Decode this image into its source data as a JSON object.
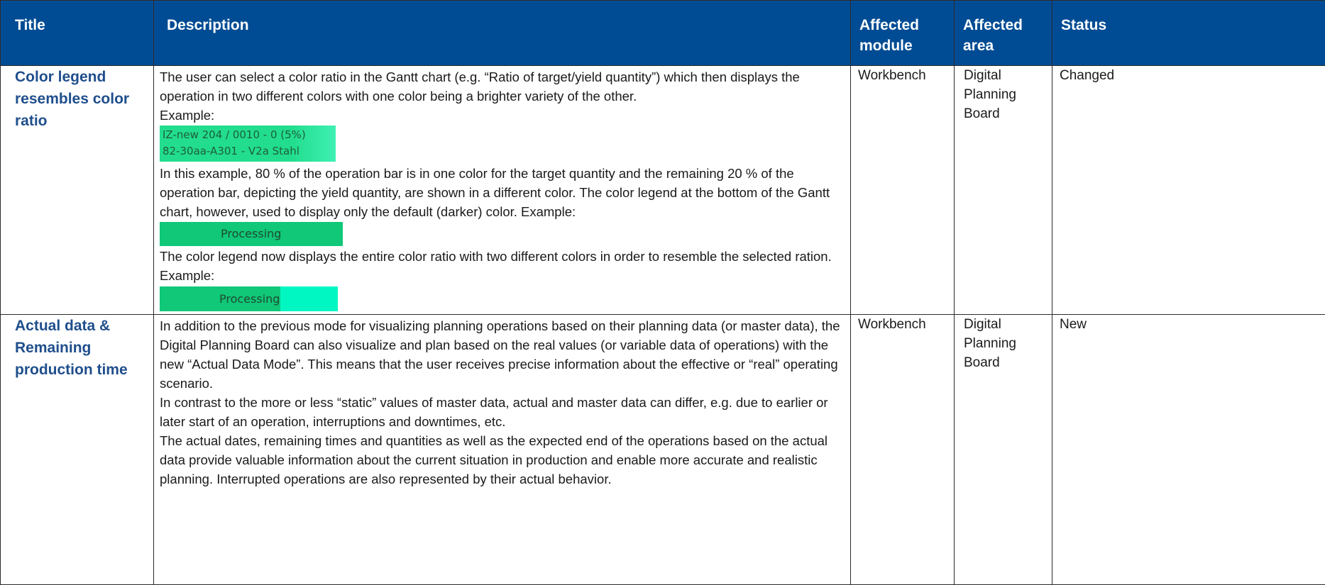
{
  "header": {
    "title": "Title",
    "description": "Description",
    "affected_module": "Affected module",
    "affected_area": "Affected area",
    "status": "Status"
  },
  "rows": [
    {
      "title": "Color legend resembles color ratio",
      "desc": {
        "p1": "The user can select a color ratio in the Gantt chart (e.g. “Ratio of target/yield quantity”) which then displays the operation in two different colors with one color being a brighter variety of the other.",
        "p2": "Example:",
        "example_line1": "IZ-new 204 / 0010 - 0 (5%)",
        "example_line2": "82-30aa-A301 - V2a Stahl",
        "p3": "In this example, 80 % of the operation bar is in one color for the target quantity and the remaining 20 % of the operation bar, depicting the yield quantity, are shown in a different color. The color legend at the bottom of the Gantt chart, however, used to display only the default (darker) color. Example:",
        "legend_old": "Processing",
        "p4": "The color legend now displays the entire color ratio with two different colors in order to resemble the selected ration. Example:",
        "legend_new": "Processing"
      },
      "module": "Workbench",
      "area": "Digital Planning Board",
      "status": "Changed"
    },
    {
      "title": "Actual data & Remaining production time",
      "desc": {
        "p1": "In addition to the previous mode for visualizing planning operations based on their planning data (or master data), the Digital Planning Board can also visualize and plan based on the real values (or variable data of operations) with the new “Actual Data Mode”. This means that the user receives precise information about the effective or “real” operating scenario.",
        "p2": "In contrast to the more or less “static” values of master data, actual and master data can differ, e.g. due to earlier or later start of an operation, interruptions and downtimes, etc.",
        "p3": "The actual dates, remaining times and quantities as well as the expected end of the operations based on the actual data provide valuable information about the current situation in production and enable more accurate and realistic planning. Interrupted operations are also represented by their actual behavior."
      },
      "module": "Workbench",
      "area": "Digital Planning Board",
      "status": "New"
    }
  ],
  "colors": {
    "header_bg": "#004c94",
    "header_text": "#ffffff",
    "title_text": "#1f4e8c",
    "swatch_dark": "#10c878",
    "swatch_light": "#00f7c2"
  }
}
